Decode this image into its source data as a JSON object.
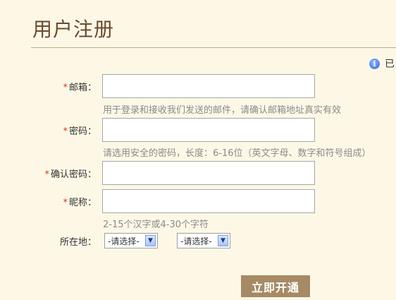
{
  "page": {
    "title": "用户注册"
  },
  "info": {
    "text": "已"
  },
  "form": {
    "email": {
      "label": "邮箱：",
      "required": "*",
      "value": "",
      "hint": "用于登录和接收我们发送的邮件，请确认邮箱地址真实有效"
    },
    "password": {
      "label": "密码：",
      "required": "*",
      "value": "",
      "hint": "请选用安全的密码，长度：6-16位（英文字母、数字和符号组成）"
    },
    "confirm_password": {
      "label": "确认密码：",
      "required": "*",
      "value": ""
    },
    "nickname": {
      "label": "昵称：",
      "required": "*",
      "value": "",
      "hint": "2-15个汉字或4-30个字符"
    },
    "location": {
      "label": "所在地：",
      "select1": "-请选择-",
      "select2": "-请选择-"
    },
    "submit_label": "立即开通"
  },
  "colors": {
    "accent": "#a68a65",
    "required": "#e0321e",
    "background": "#fdf8e6"
  }
}
